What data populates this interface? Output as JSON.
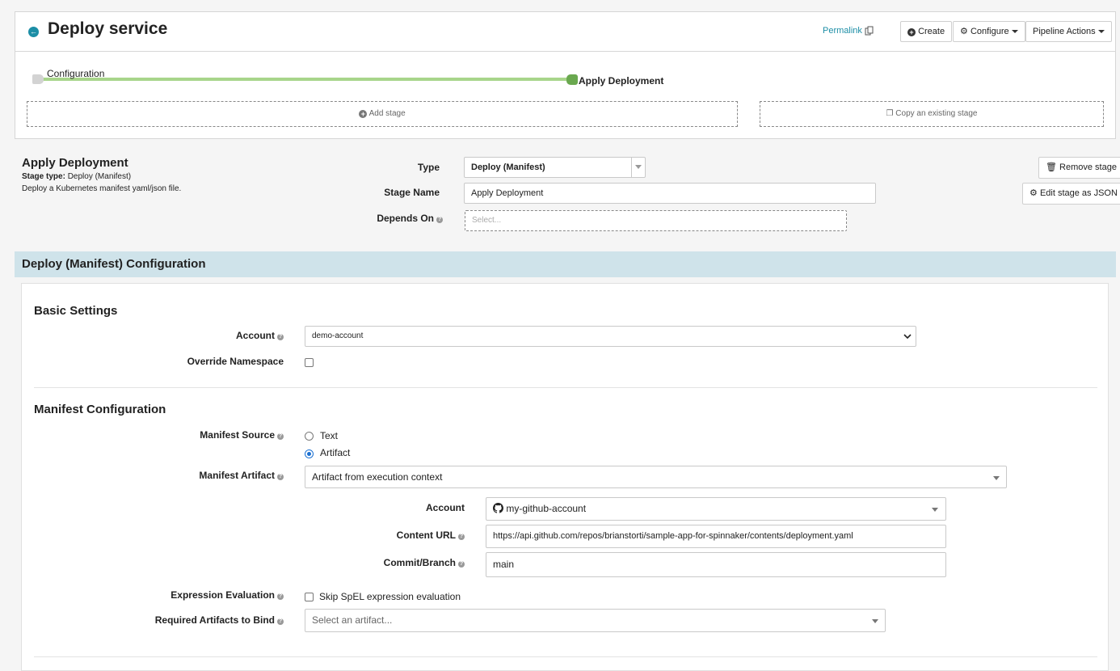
{
  "header": {
    "title": "Deploy service",
    "permalink": "Permalink",
    "create_label": "Create",
    "configure_label": "Configure",
    "pipeline_actions_label": "Pipeline Actions"
  },
  "graph": {
    "nodes": [
      "Configuration",
      "Apply Deployment"
    ],
    "add_stage": "Add stage",
    "copy_stage": "Copy an existing stage"
  },
  "stage": {
    "title": "Apply Deployment",
    "type_prefix": "Stage type:",
    "type_value": "Deploy (Manifest)",
    "description": "Deploy a Kubernetes manifest yaml/json file.",
    "type_label": "Type",
    "type_select": "Deploy (Manifest)",
    "name_label": "Stage Name",
    "name_value": "Apply Deployment",
    "depends_label": "Depends On",
    "depends_placeholder": "Select...",
    "remove_label": "Remove stage",
    "edit_json_label": "Edit stage as JSON"
  },
  "config": {
    "section_title": "Deploy (Manifest) Configuration",
    "basic_title": "Basic Settings",
    "account_label": "Account",
    "account_value": "demo-account",
    "override_ns_label": "Override Namespace",
    "manifest_title": "Manifest Configuration",
    "manifest_source_label": "Manifest Source",
    "source_text": "Text",
    "source_artifact": "Artifact",
    "manifest_artifact_label": "Manifest Artifact",
    "manifest_artifact_value": "Artifact from execution context",
    "artifact_account_label": "Account",
    "artifact_account_value": "my-github-account",
    "content_url_label": "Content URL",
    "content_url_value": "https://api.github.com/repos/brianstorti/sample-app-for-spinnaker/contents/deployment.yaml",
    "commit_label": "Commit/Branch",
    "commit_value": "main",
    "expression_label": "Expression Evaluation",
    "skip_spel_label": "Skip SpEL expression evaluation",
    "required_artifacts_label": "Required Artifacts to Bind",
    "required_artifacts_placeholder": "Select an artifact..."
  },
  "colors": {
    "accent": "#1c8ea6",
    "graph_line": "#a8d58b",
    "graph_node_end": "#6aa84f",
    "section_header": "#cfe3ea"
  },
  "icons": [
    "back-arrow-icon",
    "copy-icon",
    "plus-circle-icon",
    "gear-icon",
    "trash-icon",
    "copy-icon",
    "github-icon",
    "help-icon",
    "caret-down-icon"
  ]
}
